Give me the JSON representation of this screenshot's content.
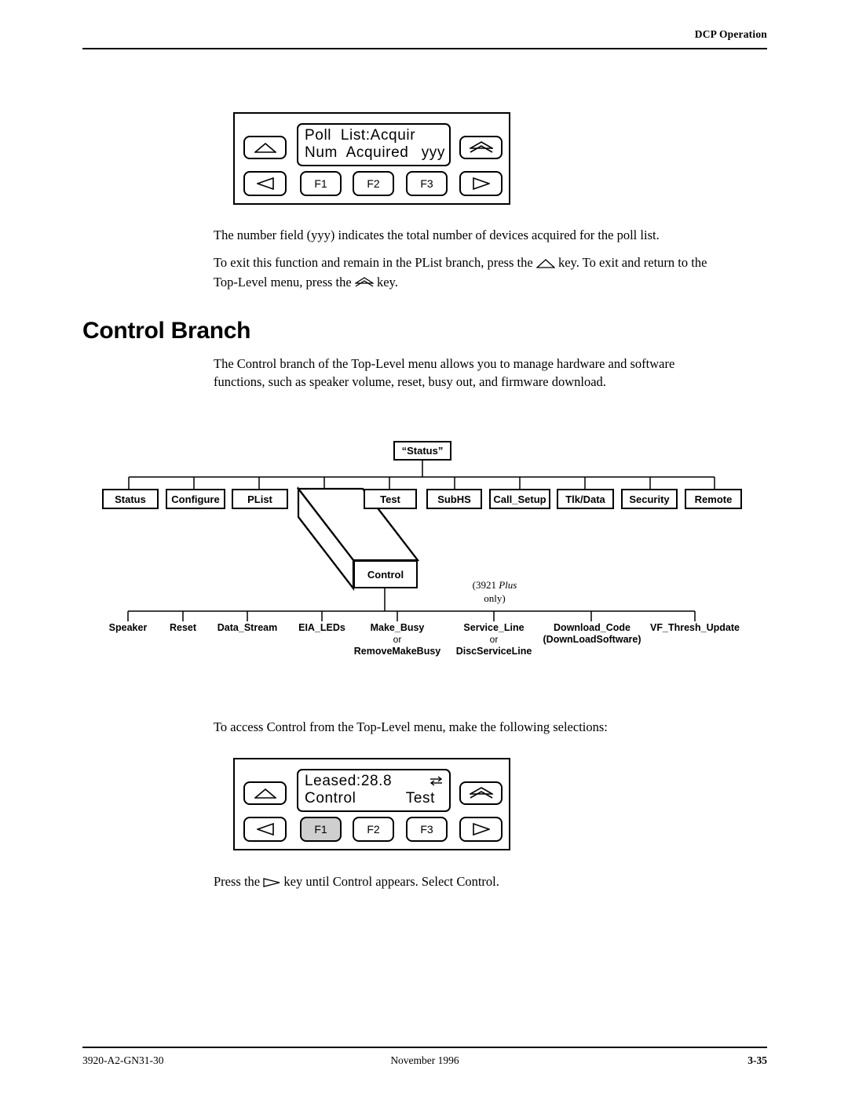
{
  "header": {
    "title": "DCP Operation"
  },
  "footer": {
    "doc_number": "3920-A2-GN31-30",
    "date": "November 1996",
    "page": "3-35"
  },
  "heading": {
    "text": "Control Branch"
  },
  "paragraphs": {
    "p1": "The number field (yyy) indicates the total number of devices acquired for the poll list.",
    "p2a": "To exit this function and remain in the PList branch, press the",
    "p2b": "key. To exit and return to the",
    "p2c": "Top-Level menu, press the",
    "p2d": "key.",
    "p3": "The Control branch of the Top-Level menu allows you to manage hardware and software functions, such as speaker volume, reset, busy out, and firmware download.",
    "p4": "To access Control from the Top-Level menu, make the following selections:",
    "p5a": "Press the",
    "p5b": "key until Control appears. Select Control."
  },
  "panel_top": {
    "lcd_line1": "Poll  List:Acquir",
    "lcd_line2_left": "Num  Acquired",
    "lcd_line2_right": "yyy",
    "keys": {
      "up": "up-triangle-icon",
      "home": "home-double-triangle-icon",
      "left": "left-triangle-icon",
      "right": "right-triangle-icon",
      "f1": "F1",
      "f2": "F2",
      "f3": "F3"
    }
  },
  "panel_bottom": {
    "lcd_line1": "Leased:28.8",
    "lcd_icon": "swap-arrows-icon",
    "lcd_line2_left": "Control",
    "lcd_line2_right": "Test",
    "keys": {
      "up": "up-triangle-icon",
      "home": "home-double-triangle-icon",
      "left": "left-triangle-icon",
      "right": "right-triangle-icon",
      "f1": "F1",
      "f2": "F2",
      "f3": "F3"
    },
    "highlighted_key": "F1"
  },
  "tree": {
    "root": "“Status”",
    "level1": [
      "Status",
      "Configure",
      "PList",
      "Control",
      "Test",
      "SubHS",
      "Call_Setup",
      "Tlk/Data",
      "Security",
      "Remote"
    ],
    "selected": "Control",
    "note": {
      "line1_pre": "(3921 ",
      "line1_em": "Plus",
      "line2": "only)"
    },
    "level2": [
      {
        "label": "Speaker"
      },
      {
        "label": "Reset"
      },
      {
        "label": "Data_Stream"
      },
      {
        "label": "EIA_LEDs"
      },
      {
        "label": "Make_Busy",
        "or": "or",
        "alt": "RemoveMakeBusy"
      },
      {
        "label": "Service_Line",
        "or": "or",
        "alt": "DiscServiceLine"
      },
      {
        "label": "Download_Code",
        "alt": "(DownLoadSoftware)"
      },
      {
        "label": "VF_Thresh_Update"
      }
    ]
  }
}
